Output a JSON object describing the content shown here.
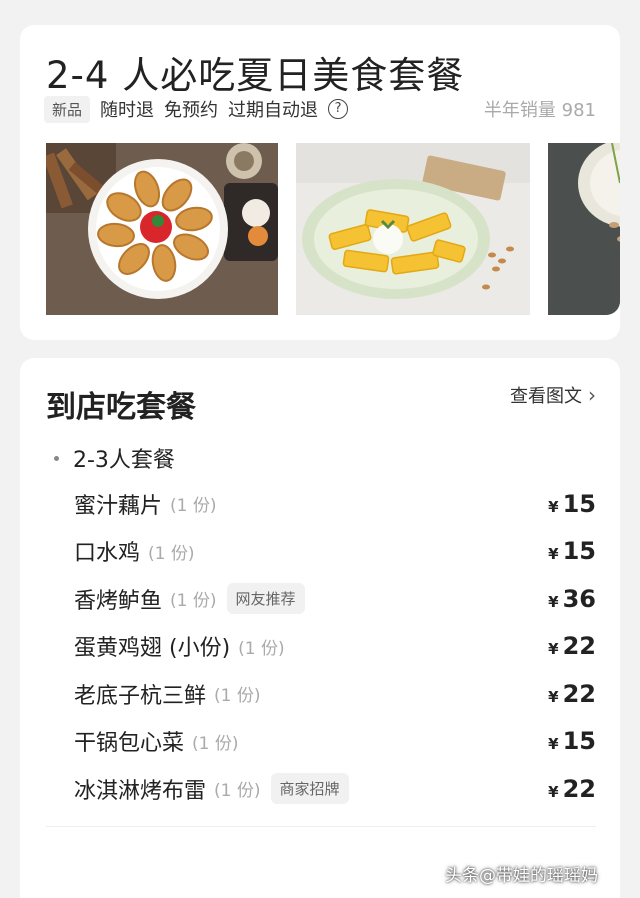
{
  "product": {
    "title": "2-4 人必吃夏日美食套餐",
    "badge": "新品",
    "tags": [
      "随时退",
      "免预约",
      "过期自动退"
    ],
    "help_icon": "?",
    "sales": "半年销量 981",
    "photos": [
      {
        "name": "fried-chicken-wings-photo"
      },
      {
        "name": "mango-dessert-photo"
      },
      {
        "name": "side-dish-photo"
      }
    ]
  },
  "menu": {
    "title": "到店吃套餐",
    "view_link": "查看图文",
    "chevron": "›",
    "group_title": "2-3人套餐",
    "currency": "¥",
    "items": [
      {
        "name": "蜜汁藕片",
        "qty": "(1 份)",
        "tag": "",
        "price": "15"
      },
      {
        "name": "口水鸡",
        "qty": "(1 份)",
        "tag": "",
        "price": "15"
      },
      {
        "name": "香烤鲈鱼",
        "qty": "(1 份)",
        "tag": "网友推荐",
        "price": "36"
      },
      {
        "name": "蛋黄鸡翅 (小份)",
        "qty": "(1 份)",
        "tag": "",
        "price": "22"
      },
      {
        "name": "老底子杭三鲜",
        "qty": "(1 份)",
        "tag": "",
        "price": "22"
      },
      {
        "name": "干锅包心菜",
        "qty": "(1 份)",
        "tag": "",
        "price": "15"
      },
      {
        "name": "冰淇淋烤布雷",
        "qty": "(1 份)",
        "tag": "商家招牌",
        "price": "22"
      }
    ]
  },
  "watermark": "头条@带娃的瑶瑶妈"
}
